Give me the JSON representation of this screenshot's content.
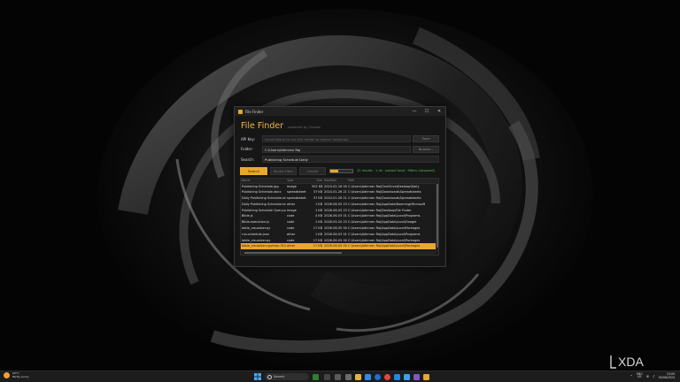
{
  "window": {
    "title": "File Finder",
    "minimize": "—",
    "maximize": "☐",
    "close": "✕"
  },
  "app": {
    "title": "File Finder",
    "powered_by": "powered by Claude"
  },
  "form": {
    "api_key_label": "API Key:",
    "api_key_placeholder": "Leave blank to use the model to search (optional)",
    "save_label": "Save",
    "folder_label": "Folder:",
    "folder_value": "C:\\Users\\Adimran Raj",
    "browse_label": "Browse...",
    "search_label": "Search:",
    "search_value": "Publishing Schedule Daily"
  },
  "controls": {
    "search_button": "Search",
    "second_button": "Saved Filter",
    "cancel_button": "Cancel",
    "progress": 0.35,
    "status": "12 results · 1.4s · parsed local · filters: (keyword)"
  },
  "table": {
    "columns": [
      "Name",
      "Type",
      "Size",
      "Modified",
      "Path"
    ],
    "rows": [
      {
        "name": "Publishing Schedule.jpg",
        "type": "image",
        "size": "302 KB",
        "modified": "2024-02-16 00:08",
        "path": "C:\\Users\\Adimran Raj\\OneDrive\\Desktop\\Daily",
        "selected": false
      },
      {
        "name": "Publishing Schedule.docx",
        "type": "spreadsheet",
        "size": "37 KB",
        "modified": "2024-01-26 21:57",
        "path": "C:\\Users\\Adimran Raj\\Downloads\\Spreadsheets",
        "selected": false
      },
      {
        "name": "Daily Publishing Schedule.xlsx",
        "type": "spreadsheet",
        "size": "37 KB",
        "modified": "2024-01-26 21:57",
        "path": "C:\\Users\\Adimran Raj\\Downloads\\Spreadsheets",
        "selected": false
      },
      {
        "name": "Daily Publishing Schedule.txt",
        "type": "other",
        "size": "1 KB",
        "modified": "2026-06-05 23:24",
        "path": "C:\\Users\\Adimran Raj\\AppData\\Roaming\\Microsoft",
        "selected": false
      },
      {
        "name": "Publishing Schedule Query.png",
        "type": "image",
        "size": "1 KB",
        "modified": "2026-06-05 23:23",
        "path": "C:\\Users\\Adimran Raj\\Desktop\\File Finder",
        "selected": false
      },
      {
        "name": "Bible.js",
        "type": "code",
        "size": "4 KB",
        "modified": "2026-06-03 01:11",
        "path": "C:\\Users\\Adimran Raj\\AppData\\Local\\Programs",
        "selected": false
      },
      {
        "name": "Bible-execution.js",
        "type": "code",
        "size": "1 KB",
        "modified": "2026-05-20 23:04",
        "path": "C:\\Users\\Adimran Raj\\AppData\\Local\\Google",
        "selected": false
      },
      {
        "name": "table_visualizer.py",
        "type": "code",
        "size": "17 KB",
        "modified": "2026-06-05 00:14",
        "path": "C:\\Users\\Adimran Raj\\AppData\\Local\\Packages",
        "selected": false
      },
      {
        "name": "run-schedule.json",
        "type": "other",
        "size": "1 KB",
        "modified": "2026-06-03 01:11",
        "path": "C:\\Users\\Adimran Raj\\AppData\\Local\\Programs",
        "selected": false
      },
      {
        "name": "table_visualizer.py",
        "type": "code",
        "size": "17 KB",
        "modified": "2026-06-05 00:14",
        "path": "C:\\Users\\Adimran Raj\\AppData\\Local\\Packages",
        "selected": false
      },
      {
        "name": "table_visualizer.cpython-312.pyc",
        "type": "other",
        "size": "17 KB",
        "modified": "2026-06-05 00:15",
        "path": "C:\\Users\\Adimran Raj\\AppData\\Local\\Packages",
        "selected": true
      }
    ]
  },
  "taskbar": {
    "weather_temp": "20°C",
    "weather_desc": "Partly sunny",
    "search_label": "Search",
    "lang_top": "ENG",
    "lang_bottom": "US",
    "time": "23:09",
    "date": "05/06/2024"
  },
  "watermark": "XDA"
}
